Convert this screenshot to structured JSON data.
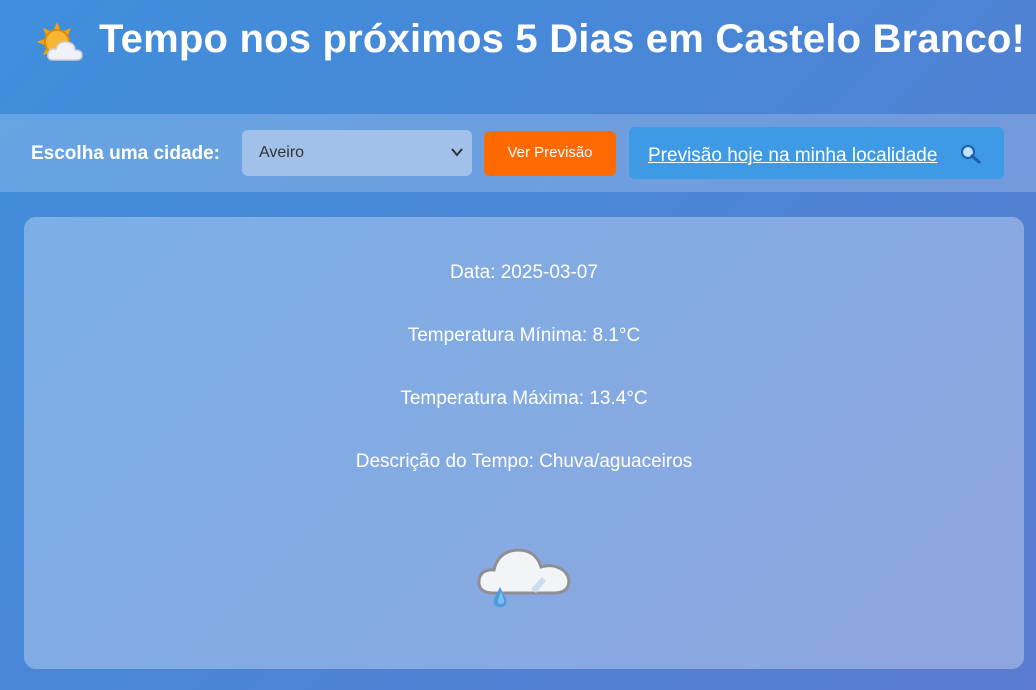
{
  "header": {
    "title": "Tempo nos próximos 5 Dias em Castelo Branco!",
    "icon": "sun-behind-cloud-icon"
  },
  "toolbar": {
    "city_label": "Escolha uma cidade:",
    "city_select_value": "Aveiro",
    "forecast_button": "Ver Previsão",
    "local_button": "Previsão hoje na minha localidade",
    "local_button_icon": "magnifier-icon"
  },
  "forecast": {
    "date": "Data: 2025-03-07",
    "min_temp": "Temperatura Mínima: 8.1°C",
    "max_temp": "Temperatura Máxima: 13.4°C",
    "description": "Descrição do Tempo: Chuva/aguaceiros",
    "icon": "rain-cloud-icon"
  },
  "colors": {
    "accent_orange": "#ff6a00",
    "accent_blue": "#3f9ae6"
  }
}
